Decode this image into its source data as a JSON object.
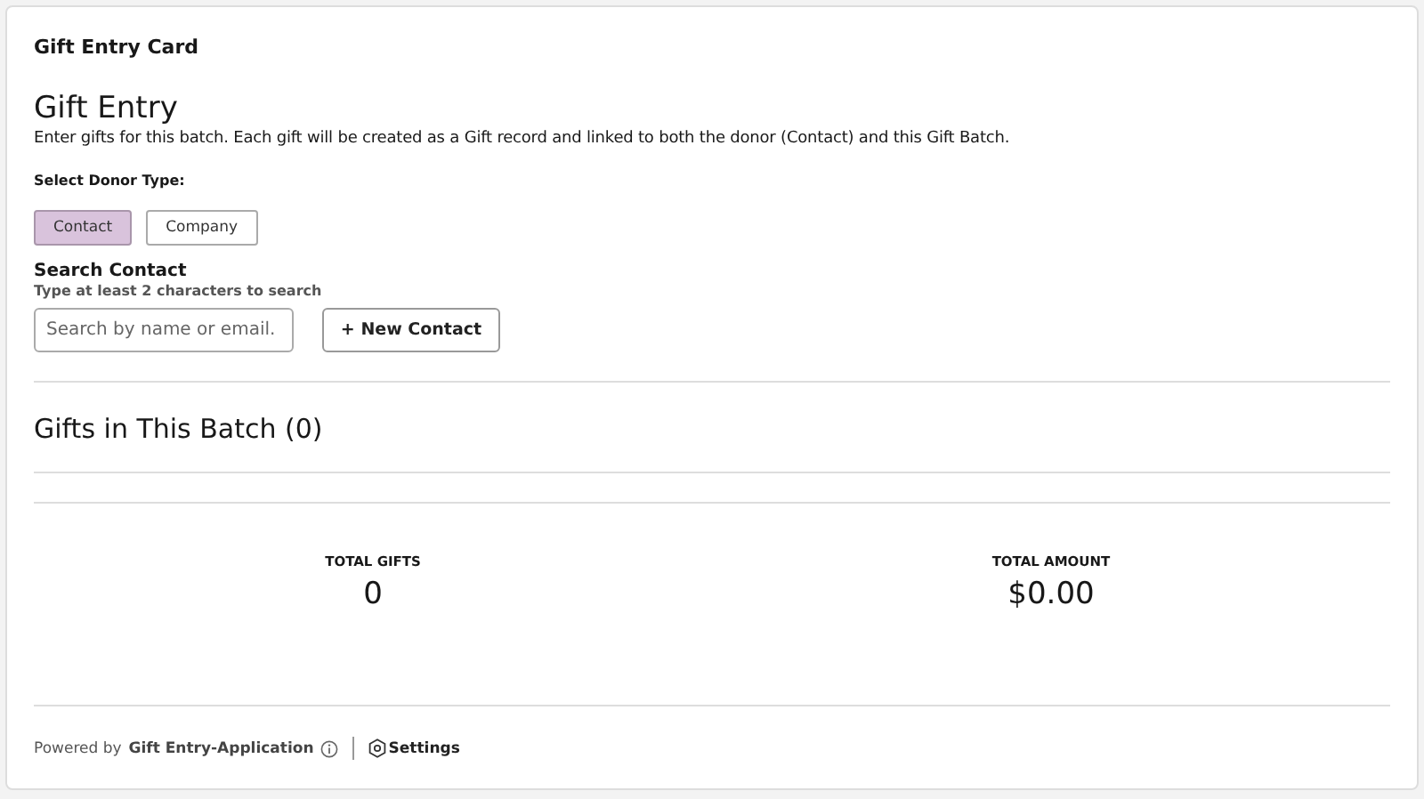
{
  "card": {
    "title": "Gift Entry Card"
  },
  "heading": "Gift Entry",
  "description": "Enter gifts for this batch. Each gift will be created as a Gift record and linked to both the donor (Contact) and this Gift Batch.",
  "donor_type": {
    "label": "Select Donor Type:",
    "options": [
      {
        "label": "Contact",
        "selected": true
      },
      {
        "label": "Company",
        "selected": false
      }
    ]
  },
  "search": {
    "label": "Search Contact",
    "hint": "Type at least 2 characters to search",
    "placeholder": "Search by name or email.",
    "new_button": "+ New Contact"
  },
  "batch": {
    "title": "Gifts in This Batch (0)"
  },
  "totals": [
    {
      "label": "TOTAL GIFTS",
      "value": "0"
    },
    {
      "label": "TOTAL AMOUNT",
      "value": "$0.00"
    }
  ],
  "footer": {
    "powered_by": "Powered by",
    "app": "Gift Entry-Application",
    "settings": "Settings"
  }
}
